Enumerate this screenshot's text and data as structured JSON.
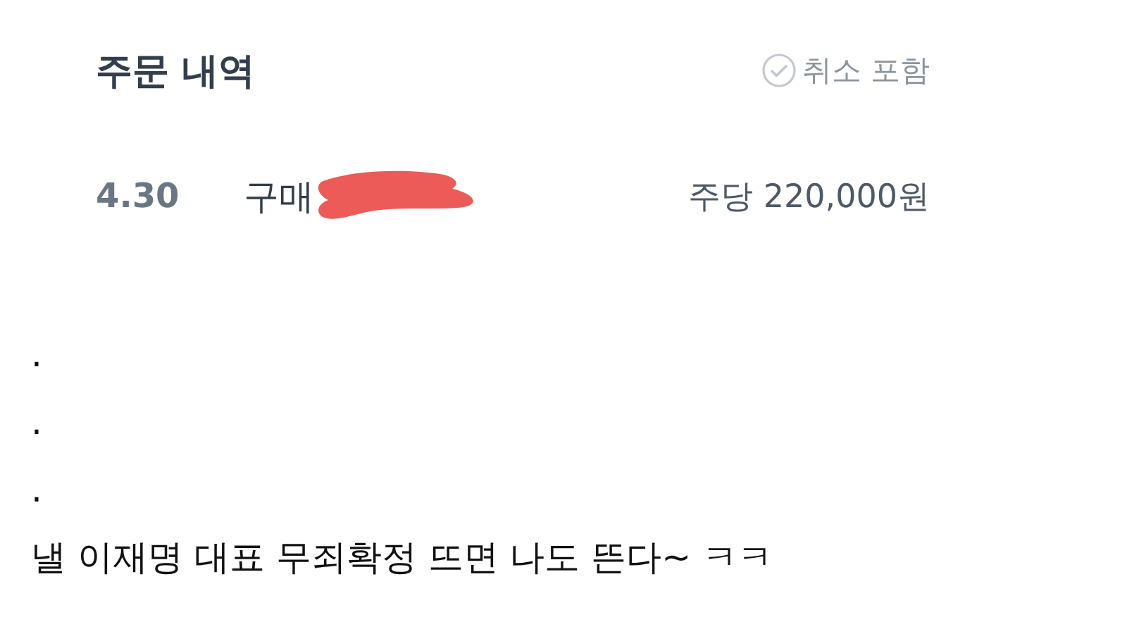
{
  "orders_panel": {
    "title": "주문 내역",
    "cancel_filter": {
      "label": "취소 포함",
      "checked": false
    },
    "orders": [
      {
        "date": "4.30",
        "type": "구매",
        "price": "주당 220,000원"
      }
    ]
  },
  "comment_lines": [
    ".",
    ".",
    ".",
    "낼 이재명 대표 무죄확정 뜨면 나도 뜬다~ ㅋㅋ"
  ]
}
